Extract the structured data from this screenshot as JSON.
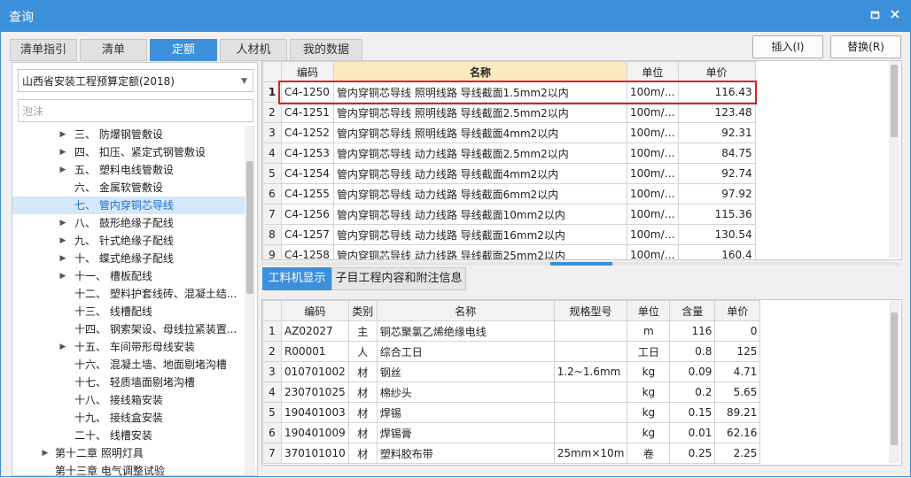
{
  "window": {
    "title": "查询",
    "restore_icon": "restore-icon",
    "close_icon": "close-icon"
  },
  "tabs": [
    "清单指引",
    "清单",
    "定额",
    "人材机",
    "我的数据"
  ],
  "active_tab": "定额",
  "buttons": {
    "insert": "插入(I)",
    "replace": "替换(R)"
  },
  "left": {
    "combo_value": "山西省安装工程预算定额(2018)",
    "search_placeholder": "泡沫",
    "tree": [
      {
        "label": "三、 防爆钢管敷设",
        "caret": "▶"
      },
      {
        "label": "四、 扣压、紧定式钢管敷设",
        "caret": "▶"
      },
      {
        "label": "五、 塑料电线管敷设",
        "caret": "▶"
      },
      {
        "label": "六、 金属软管敷设",
        "caret": ""
      },
      {
        "label": "七、 管内穿铜芯导线",
        "caret": "",
        "selected": true
      },
      {
        "label": "八、 鼓形绝缘子配线",
        "caret": "▶"
      },
      {
        "label": "九、 针式绝缘子配线",
        "caret": "▶"
      },
      {
        "label": "十、 蝶式绝缘子配线",
        "caret": "▶"
      },
      {
        "label": "十一、 槽板配线",
        "caret": "▶"
      },
      {
        "label": "十二、 塑料护套线砖、混凝土结...",
        "caret": ""
      },
      {
        "label": "十三、 线槽配线",
        "caret": ""
      },
      {
        "label": "十四、 钢索架设、母线拉紧装置...",
        "caret": ""
      },
      {
        "label": "十五、 车间带形母线安装",
        "caret": "▶"
      },
      {
        "label": "十六、 混凝土墙、地面剔堵沟槽",
        "caret": ""
      },
      {
        "label": "十七、 轻质墙面剔堵沟槽",
        "caret": ""
      },
      {
        "label": "十八、 接线箱安装",
        "caret": ""
      },
      {
        "label": "十九、 接线盒安装",
        "caret": ""
      },
      {
        "label": "二十、 线槽安装",
        "caret": ""
      },
      {
        "label": "第十二章 照明灯具",
        "caret": "▶",
        "level": 0
      },
      {
        "label": "第十三章 电气调整试验",
        "caret": "",
        "level": 0
      }
    ]
  },
  "quota_table": {
    "headers": [
      "编码",
      "名称",
      "单位",
      "单价"
    ],
    "rows": [
      {
        "n": "1",
        "code": "C4-1250",
        "name": "管内穿铜芯导线 照明线路 导线截面1.5mm2以内",
        "unit": "100m/…",
        "price": "116.43"
      },
      {
        "n": "2",
        "code": "C4-1251",
        "name": "管内穿铜芯导线 照明线路 导线截面2.5mm2以内",
        "unit": "100m/…",
        "price": "123.48"
      },
      {
        "n": "3",
        "code": "C4-1252",
        "name": "管内穿铜芯导线 照明线路 导线截面4mm2以内",
        "unit": "100m/…",
        "price": "92.31"
      },
      {
        "n": "4",
        "code": "C4-1253",
        "name": "管内穿铜芯导线 动力线路 导线截面2.5mm2以内",
        "unit": "100m/…",
        "price": "84.75"
      },
      {
        "n": "5",
        "code": "C4-1254",
        "name": "管内穿铜芯导线 动力线路 导线截面4mm2以内",
        "unit": "100m/…",
        "price": "92.74"
      },
      {
        "n": "6",
        "code": "C4-1255",
        "name": "管内穿铜芯导线 动力线路 导线截面6mm2以内",
        "unit": "100m/…",
        "price": "97.92"
      },
      {
        "n": "7",
        "code": "C4-1256",
        "name": "管内穿铜芯导线 动力线路 导线截面10mm2以内",
        "unit": "100m/…",
        "price": "115.36"
      },
      {
        "n": "8",
        "code": "C4-1257",
        "name": "管内穿铜芯导线 动力线路 导线截面16mm2以内",
        "unit": "100m/…",
        "price": "130.54"
      },
      {
        "n": "9",
        "code": "C4-1258",
        "name": "管内穿铜芯导线 动力线路 导线截面25mm2以内",
        "unit": "100m/…",
        "price": "160.4"
      }
    ]
  },
  "bottom_tabs": [
    "工料机显示",
    "子目工程内容和附注信息"
  ],
  "bottom_active": "工料机显示",
  "material_table": {
    "headers": [
      "编码",
      "类别",
      "名称",
      "规格型号",
      "单位",
      "含量",
      "单价"
    ],
    "rows": [
      {
        "n": "1",
        "code": "AZ02027",
        "cat": "主",
        "name": "铜芯聚氯乙烯绝缘电线",
        "spec": "",
        "unit": "m",
        "qty": "116",
        "price": "0"
      },
      {
        "n": "2",
        "code": "R00001",
        "cat": "人",
        "name": "综合工日",
        "spec": "",
        "unit": "工日",
        "qty": "0.8",
        "price": "125"
      },
      {
        "n": "3",
        "code": "010701002",
        "cat": "材",
        "name": "钢丝",
        "spec": "1.2~1.6mm",
        "unit": "kg",
        "qty": "0.09",
        "price": "4.71"
      },
      {
        "n": "4",
        "code": "230701025",
        "cat": "材",
        "name": "棉纱头",
        "spec": "",
        "unit": "kg",
        "qty": "0.2",
        "price": "5.65"
      },
      {
        "n": "5",
        "code": "190401003",
        "cat": "材",
        "name": "焊锡",
        "spec": "",
        "unit": "kg",
        "qty": "0.15",
        "price": "89.21"
      },
      {
        "n": "6",
        "code": "190401009",
        "cat": "材",
        "name": "焊锡膏",
        "spec": "",
        "unit": "kg",
        "qty": "0.01",
        "price": "62.16"
      },
      {
        "n": "7",
        "code": "370101010",
        "cat": "材",
        "name": "塑料胶布带",
        "spec": "25mm×10m",
        "unit": "卷",
        "qty": "0.25",
        "price": "2.25"
      }
    ]
  },
  "colors": {
    "accent": "#3c8fdb",
    "highlight_box": "#e02020",
    "selected_tree": "#d5e8fa"
  }
}
